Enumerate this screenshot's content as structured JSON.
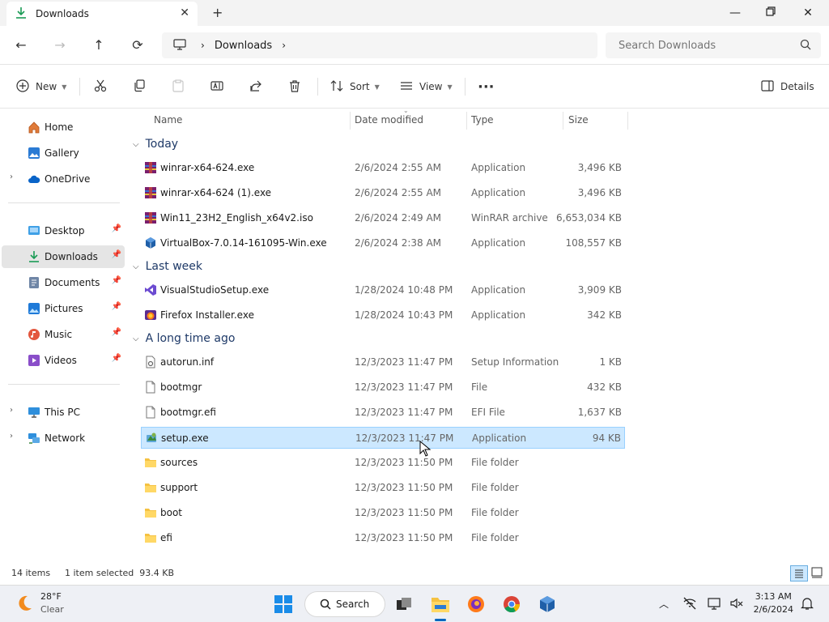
{
  "window": {
    "tab_title": "Downloads"
  },
  "address": {
    "crumbs": [
      "Downloads"
    ],
    "search_placeholder": "Search Downloads"
  },
  "toolbar": {
    "new_label": "New",
    "sort_label": "Sort",
    "view_label": "View",
    "details_label": "Details"
  },
  "sidebar": {
    "items": [
      {
        "label": "Home",
        "icon": "home-icon"
      },
      {
        "label": "Gallery",
        "icon": "gallery-icon"
      },
      {
        "label": "OneDrive",
        "icon": "cloud-icon"
      },
      {
        "label": "Desktop",
        "icon": "desktop-icon"
      },
      {
        "label": "Downloads",
        "icon": "download-icon"
      },
      {
        "label": "Documents",
        "icon": "documents-icon"
      },
      {
        "label": "Pictures",
        "icon": "pictures-icon"
      },
      {
        "label": "Music",
        "icon": "music-icon"
      },
      {
        "label": "Videos",
        "icon": "videos-icon"
      },
      {
        "label": "This PC",
        "icon": "computer-icon"
      },
      {
        "label": "Network",
        "icon": "network-icon"
      }
    ]
  },
  "columns": {
    "name": "Name",
    "date": "Date modified",
    "type": "Type",
    "size": "Size"
  },
  "groups": [
    {
      "label": "Today",
      "files": [
        {
          "name": "winrar-x64-624.exe",
          "date": "2/6/2024 2:55 AM",
          "type": "Application",
          "size": "3,496 KB",
          "icon": "winrar-icon"
        },
        {
          "name": "winrar-x64-624 (1).exe",
          "date": "2/6/2024 2:55 AM",
          "type": "Application",
          "size": "3,496 KB",
          "icon": "winrar-icon"
        },
        {
          "name": "Win11_23H2_English_x64v2.iso",
          "date": "2/6/2024 2:49 AM",
          "type": "WinRAR archive",
          "size": "6,653,034 KB",
          "icon": "winrar-icon"
        },
        {
          "name": "VirtualBox-7.0.14-161095-Win.exe",
          "date": "2/6/2024 2:38 AM",
          "type": "Application",
          "size": "108,557 KB",
          "icon": "virtualbox-icon"
        }
      ]
    },
    {
      "label": "Last week",
      "files": [
        {
          "name": "VisualStudioSetup.exe",
          "date": "1/28/2024 10:48 PM",
          "type": "Application",
          "size": "3,909 KB",
          "icon": "visual-studio-icon"
        },
        {
          "name": "Firefox Installer.exe",
          "date": "1/28/2024 10:43 PM",
          "type": "Application",
          "size": "342 KB",
          "icon": "firefox-icon"
        }
      ]
    },
    {
      "label": "A long time ago",
      "files": [
        {
          "name": "autorun.inf",
          "date": "12/3/2023 11:47 PM",
          "type": "Setup Information",
          "size": "1 KB",
          "icon": "settings-file-icon"
        },
        {
          "name": "bootmgr",
          "date": "12/3/2023 11:47 PM",
          "type": "File",
          "size": "432 KB",
          "icon": "file-icon"
        },
        {
          "name": "bootmgr.efi",
          "date": "12/3/2023 11:47 PM",
          "type": "EFI File",
          "size": "1,637 KB",
          "icon": "file-icon"
        },
        {
          "name": "setup.exe",
          "date": "12/3/2023 11:47 PM",
          "type": "Application",
          "size": "94 KB",
          "icon": "setup-icon"
        },
        {
          "name": "sources",
          "date": "12/3/2023 11:50 PM",
          "type": "File folder",
          "size": "",
          "icon": "folder-icon"
        },
        {
          "name": "support",
          "date": "12/3/2023 11:50 PM",
          "type": "File folder",
          "size": "",
          "icon": "folder-icon"
        },
        {
          "name": "boot",
          "date": "12/3/2023 11:50 PM",
          "type": "File folder",
          "size": "",
          "icon": "folder-icon"
        },
        {
          "name": "efi",
          "date": "12/3/2023 11:50 PM",
          "type": "File folder",
          "size": "",
          "icon": "folder-icon"
        }
      ]
    }
  ],
  "status": {
    "items": "14 items",
    "selection": "1 item selected  93.4 KB"
  },
  "taskbar": {
    "temp": "28°F",
    "weather": "Clear",
    "search_label": "Search",
    "time": "3:13 AM",
    "date": "2/6/2024"
  },
  "colors": {
    "accent": "#0067c0",
    "selection": "#cce8ff",
    "folder": "#f5c242"
  }
}
